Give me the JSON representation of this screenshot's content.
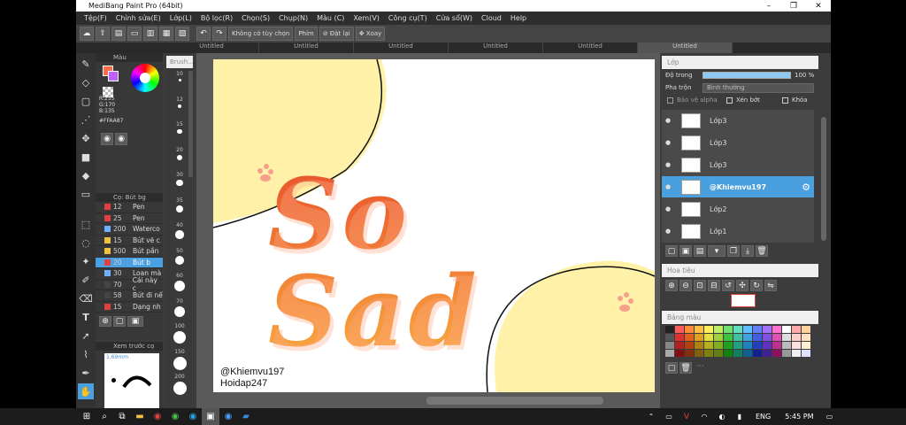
{
  "window": {
    "title": "MediBang Paint Pro (64bit)",
    "controls": [
      "–",
      "❐",
      "✕"
    ]
  },
  "menu": [
    "Tệp(F)",
    "Chỉnh sửa(E)",
    "Lớp(L)",
    "Bộ lọc(R)",
    "Chọn(S)",
    "Chụp(N)",
    "Màu (C)",
    "Xem(V)",
    "Công cụ(T)",
    "Cửa sổ(W)",
    "Cloud",
    "Help"
  ],
  "toolbar": {
    "no_selection": "Không có tùy chọn",
    "key_label": "Phím",
    "reset": "Đặt lại",
    "rotate": "Xoay"
  },
  "tabs": [
    "Untitled",
    "Untitled",
    "Untitled",
    "Untitled",
    "Untitled",
    "Untitled"
  ],
  "color_panel": {
    "title": "Màu",
    "r": "R:255",
    "g": "G:170",
    "b": "B:135",
    "hex": "#FFAA87",
    "fg_color": "#ff6a4a",
    "bg_color": "#ffffff"
  },
  "brush_list": {
    "title": "Cọ: Bút bg",
    "items": [
      {
        "size": "12",
        "name": "Pen",
        "color": "#e04040"
      },
      {
        "size": "25",
        "name": "Pen",
        "color": "#e04040"
      },
      {
        "size": "200",
        "name": "Waterco",
        "color": "#70b0ff"
      },
      {
        "size": "15",
        "name": "Bút vẽ c",
        "color": "#f0c040"
      },
      {
        "size": "500",
        "name": "Bút pần",
        "color": "#f0c040"
      },
      {
        "size": "20",
        "name": "Bút b",
        "color": "#e04040"
      },
      {
        "size": "30",
        "name": "Loan mà",
        "color": "#70b0ff"
      },
      {
        "size": "70",
        "name": "Cái này c",
        "color": "#444444"
      },
      {
        "size": "58",
        "name": "Bút đi nế",
        "color": "#444444"
      },
      {
        "size": "15",
        "name": "Dạng nh",
        "color": "#e04040"
      }
    ]
  },
  "preview": {
    "title": "Xem trước cọ",
    "size": "1.69mm"
  },
  "brush_sizes": {
    "label": "Brush...",
    "sizes": [
      "10",
      "12",
      "15",
      "20",
      "30",
      "35",
      "40",
      "50",
      "60",
      "70",
      "100",
      "150",
      "200"
    ]
  },
  "canvas": {
    "text": "So Sad",
    "credit1": "@Khiemvu197",
    "credit2": "Hoidap247"
  },
  "layer_panel": {
    "title": "Lớp",
    "opacity_label": "Độ trong",
    "opacity_value": "100 %",
    "blend_label": "Pha trộn",
    "blend_value": "Bình thường",
    "protect_alpha": "Bảo vệ alpha",
    "clipping": "Xén bớt",
    "lock": "Khóa",
    "layers": [
      {
        "name": "Lớp3"
      },
      {
        "name": "Lớp3"
      },
      {
        "name": "Lớp3"
      },
      {
        "name": "@Khiemvu197"
      },
      {
        "name": "Lớp2"
      },
      {
        "name": "Lớp1"
      }
    ]
  },
  "navigator": {
    "title": "Hoa tiêu"
  },
  "palette_panel": {
    "title": "Bảng màu"
  },
  "taskbar": {
    "lang": "ENG",
    "time": "5:45 PM"
  }
}
